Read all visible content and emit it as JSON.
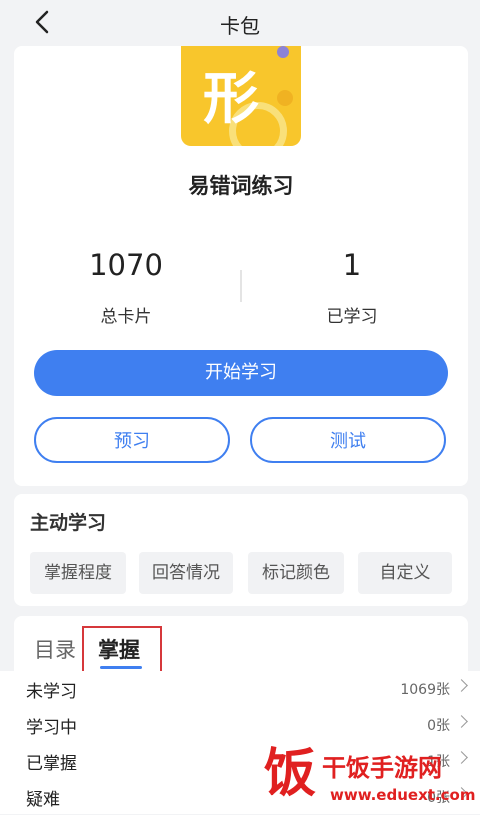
{
  "header": {
    "title": "卡包"
  },
  "deck": {
    "logo_glyph": "形",
    "name": "易错词练习",
    "total_cards": "1070",
    "total_cards_label": "总卡片",
    "learned": "1",
    "learned_label": "已学习"
  },
  "actions": {
    "start": "开始学习",
    "preview": "预习",
    "test": "测试"
  },
  "active_learning": {
    "title": "主动学习",
    "chips": [
      "掌握程度",
      "回答情况",
      "标记颜色",
      "自定义"
    ]
  },
  "tabs": [
    {
      "label": "目录",
      "active": false
    },
    {
      "label": "掌握",
      "active": true
    }
  ],
  "mastery_list": [
    {
      "label": "未学习",
      "count": "1069张"
    },
    {
      "label": "学习中",
      "count": "0张"
    },
    {
      "label": "已掌握",
      "count": "1张"
    },
    {
      "label": "疑难",
      "count": "0张"
    }
  ],
  "watermark": {
    "icon": "饭",
    "name": "干饭手游网",
    "url": "www.eduext.com"
  },
  "colors": {
    "accent": "#3f7ff0",
    "logo_bg": "#f8c62c",
    "highlight_box": "#d6383b",
    "watermark": "#e02020"
  }
}
